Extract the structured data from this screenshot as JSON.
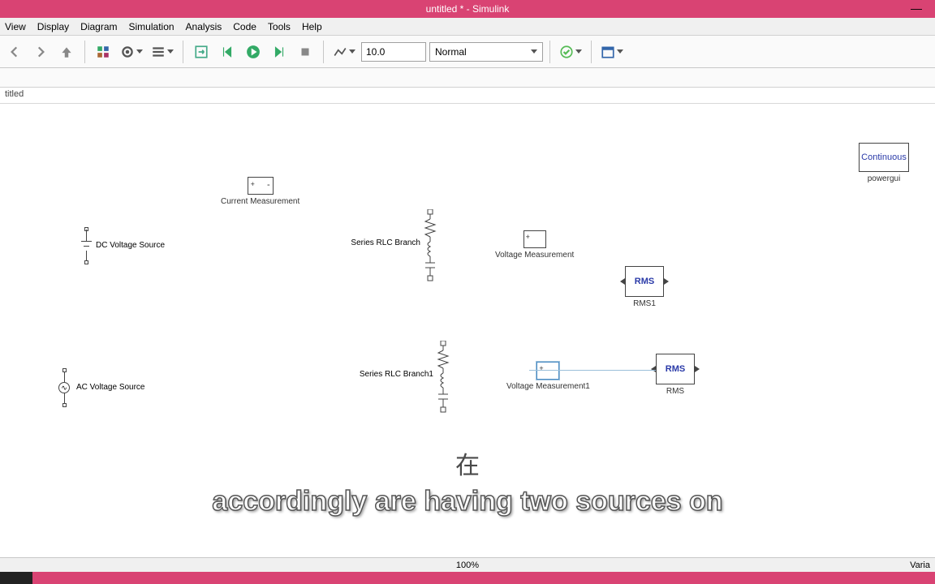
{
  "window": {
    "title": "untitled * - Simulink"
  },
  "menu": {
    "view": "View",
    "display": "Display",
    "diagram": "Diagram",
    "simulation": "Simulation",
    "analysis": "Analysis",
    "code": "Code",
    "tools": "Tools",
    "help": "Help"
  },
  "toolbar": {
    "stop_time": "10.0",
    "sim_mode": "Normal"
  },
  "breadcrumb": {
    "path": "titled"
  },
  "blocks": {
    "current_meas": "Current Measurement",
    "dc_source": "DC Voltage Source",
    "ac_source": "AC Voltage Source",
    "rlc": "Series RLC Branch",
    "rlc1": "Series RLC Branch1",
    "vm": "Voltage Measurement",
    "vm1": "Voltage Measurement1",
    "rms_txt": "RMS",
    "rms1_lbl": "RMS1",
    "rms_lbl": "RMS",
    "cont": "Continuous",
    "powergui": "powergui"
  },
  "subtitles": {
    "cn": "在",
    "en": "accordingly are having two sources on"
  },
  "status": {
    "zoom": "100%",
    "right": "Varia"
  }
}
